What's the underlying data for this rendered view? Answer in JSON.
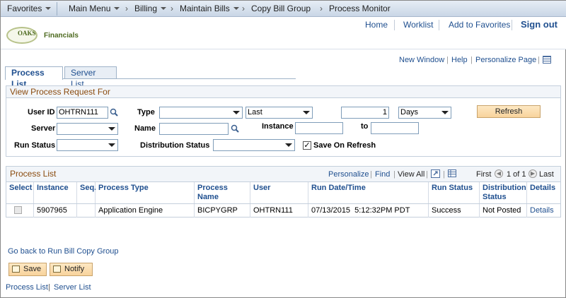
{
  "nav": {
    "favorites": "Favorites",
    "main_menu": "Main Menu",
    "breadcrumb": [
      "Billing",
      "Maintain Bills",
      "Copy Bill Group",
      "Process Monitor"
    ]
  },
  "header": {
    "logo_text": "OAKS",
    "logo_sub": "Financials",
    "links": [
      "Home",
      "Worklist",
      "Add to Favorites"
    ],
    "sign_out": "Sign out"
  },
  "page_links": {
    "new_window": "New Window",
    "help": "Help",
    "personalize": "Personalize Page"
  },
  "tabs": {
    "process_list": "Process List",
    "server_list": "Server List"
  },
  "filter": {
    "title": "View Process Request For",
    "user_id_label": "User ID",
    "user_id_value": "OHTRN111",
    "type_label": "Type",
    "type_value": "",
    "last_value": "Last",
    "count_value": "1",
    "days_value": "Days",
    "refresh": "Refresh",
    "server_label": "Server",
    "server_value": "",
    "name_label": "Name",
    "name_value": "",
    "instance_label": "Instance",
    "instance_from": "",
    "to_label": "to",
    "instance_to": "",
    "run_status_label": "Run Status",
    "run_status_value": "",
    "dist_status_label": "Distribution Status",
    "dist_status_value": "",
    "save_on_refresh": "Save On Refresh",
    "save_on_refresh_checked": "✓"
  },
  "grid": {
    "title": "Process List",
    "personalize": "Personalize",
    "find": "Find",
    "view_all": "View All",
    "first": "First",
    "range": "1 of 1",
    "last": "Last",
    "headers": [
      "Select",
      "Instance",
      "Seq.",
      "Process Type",
      "Process Name",
      "User",
      "Run Date/Time",
      "Run Status",
      "Distribution Status",
      "Details"
    ],
    "rows": [
      {
        "instance": "5907965",
        "seq": "",
        "process_type": "Application Engine",
        "process_name": "BICPYGRP",
        "user": "OHTRN111",
        "run_datetime": "07/13/2015  5:12:32PM PDT",
        "run_status": "Success",
        "dist_status": "Not Posted",
        "details": "Details"
      }
    ]
  },
  "bottom": {
    "go_back": "Go back to Run Bill Copy Group",
    "save": "Save",
    "notify": "Notify",
    "process_list": "Process List",
    "server_list": "Server List"
  }
}
